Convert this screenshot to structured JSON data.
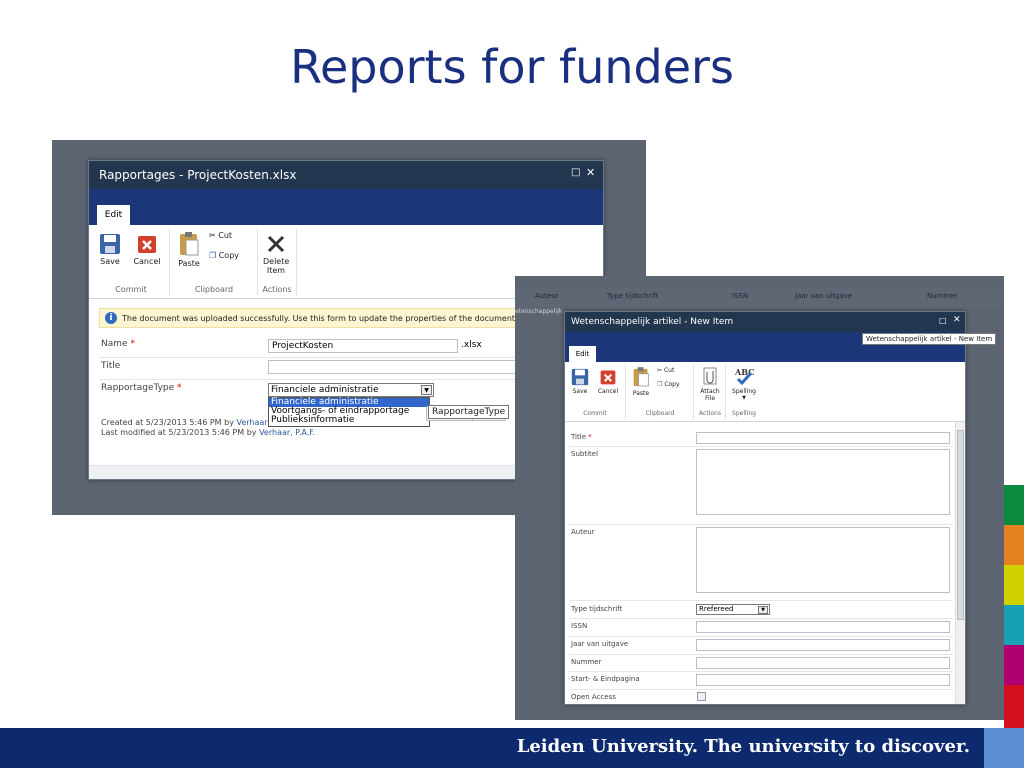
{
  "slide": {
    "title": "Reports for funders",
    "footer": "Leiden University. The university to discover."
  },
  "colors": {
    "title": "#1a2f80",
    "footer_bar": "#0e2a6e",
    "ribbon": "#1c3777",
    "side_bands": [
      "#0a8a3e",
      "#e6811f",
      "#cfd200",
      "#18a0b4",
      "#b0006e",
      "#d41020"
    ]
  },
  "dialog1": {
    "title": "Rapportages - ProjectKosten.xlsx",
    "tab": "Edit",
    "ribbon": {
      "save": "Save",
      "cancel": "Cancel",
      "paste": "Paste",
      "cut": "Cut",
      "copy": "Copy",
      "delete": "Delete Item",
      "group_commit": "Commit",
      "group_clipboard": "Clipboard",
      "group_actions": "Actions"
    },
    "notice": "The document was uploaded successfully. Use this form to update the properties of the document.",
    "fields": {
      "name_label": "Name",
      "name_value": "ProjectKosten",
      "name_ext": ".xlsx",
      "title_label": "Title",
      "type_label": "RapportageType",
      "type_value": "Financiele administratie"
    },
    "dropdown_options": [
      "Financiele administratie",
      "Voortgangs- of eindrapportage",
      "Publieksinformatie"
    ],
    "tooltip": "RapportageType",
    "created_prefix": "Created at 5/23/2013 5:46 PM by ",
    "created_by": "Verhaar",
    "modified_prefix": "Last modified at 5/23/2013 5:46 PM by ",
    "modified_by": "Verhaar, P.A.F."
  },
  "list_headers": [
    "Auteur",
    "Type tijdschrift",
    "ISSN",
    "Jaar van uitgave",
    "Nummer"
  ],
  "list_row_fragment": "etenschappelijk",
  "dialog2": {
    "title": "Wetenschappelijk artikel - New Item",
    "tooltip": "Wetenschappelijk artikel - New Item",
    "tab": "Edit",
    "ribbon": {
      "save": "Save",
      "cancel": "Cancel",
      "paste": "Paste",
      "cut": "Cut",
      "copy": "Copy",
      "attach": "Attach File",
      "spelling": "Spelling",
      "group_commit": "Commit",
      "group_clipboard": "Clipboard",
      "group_actions": "Actions",
      "group_spelling": "Spelling"
    },
    "fields": {
      "title": "Title",
      "subtitel": "Subtitel",
      "auteur": "Auteur",
      "type_tijdschrift": "Type tijdschrift",
      "type_value": "Rrefereed",
      "issn": "ISSN",
      "jaar": "Jaar van uitgave",
      "nummer": "Nummer",
      "pagina": "Start- & Eindpagina",
      "open_access": "Open Access"
    }
  }
}
